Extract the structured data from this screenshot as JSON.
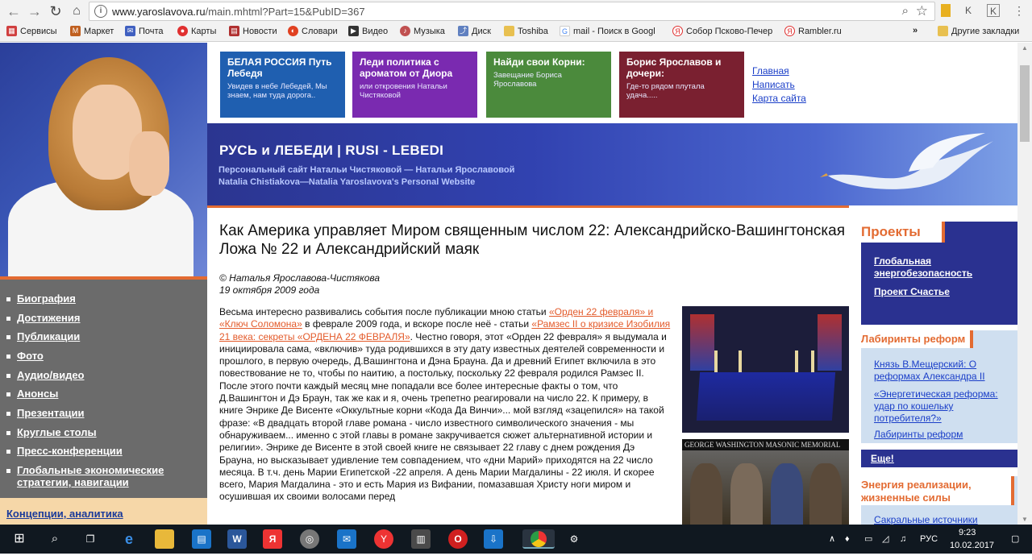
{
  "browser": {
    "url_host": "www.yaroslavova.ru",
    "url_path": "/main.mhtml?Part=15&PubID=367",
    "bookmarks": [
      "Сервисы",
      "Маркет",
      "Почта",
      "Карты",
      "Новости",
      "Словари",
      "Видео",
      "Музыка",
      "Диск",
      "Toshiba",
      "mail - Поиск в Googl",
      "Собор Псково-Печер",
      "Rambler.ru"
    ],
    "more_bookmarks": "»",
    "other_bookmarks": "Другие закладки"
  },
  "tiles": [
    {
      "title": "БЕЛАЯ РОССИЯ Путь Лебедя",
      "sub": "Увидев в небе Лебедей, Мы знаем, нам туда дорога..",
      "color": "#1f5fb0"
    },
    {
      "title": "Леди политика с ароматом от Диора",
      "sub": "или откровения Натальи Чистяковой",
      "color": "#7a2ab0"
    },
    {
      "title": "Найди свои Корни:",
      "sub": "Завещание Бориса Ярославова",
      "color": "#4b8a3c"
    },
    {
      "title": "Борис Ярославов и дочери:",
      "sub": "Где-то рядом плутала удача.....",
      "color": "#7a2030"
    }
  ],
  "toplinks": [
    "Главная",
    "Написать",
    "Карта сайта"
  ],
  "banner": {
    "title": "РУСЬ и ЛЕБЕДИ | RUSI - LEBEDI",
    "sub1": "Персональный сайт Натальи Чистяковой — Натальи Ярославовой",
    "sub2": "Natalia Chistiakova—Natalia Yaroslavova's Personal Website"
  },
  "leftmenu": [
    "Биография",
    "Достижения",
    "Публикации",
    "Фото",
    "Аудио/видео",
    "Анонсы",
    "Презентации",
    "Круглые столы",
    "Пресс-конференции",
    "Глобальные экономические",
    "стратегии, навигации"
  ],
  "leftlower": "Концепции, аналитика",
  "article": {
    "title": "Как Америка управляет Миром священным числом 22: Александрийско-Вашингтонская Ложа № 22 и Александрийский маяк",
    "author": "© Наталья Ярославова-Чистякова",
    "date": "19 октября 2009 года",
    "p1_a": "Весьма интересно развивались события после публикации мною статьи ",
    "link1": "«Орден 22 февраля» и «Ключ Соломона»",
    "p1_b": " в феврале 2009 года, и вскоре после неё - статьи ",
    "link2": "«Рамзес II о кризисе Изобилия 21 века: секреты «ОРДЕНА 22 ФЕВРАЛЯ»",
    "p1_c": ". Честно говоря, этот «Орден 22 февраля» я выдумала и инициировала сама, «включив» туда родившихся в эту дату известных деятелей современности и прошлого, в первую очередь, Д.Вашингтона и Дэна Брауна. Да и древний Египет включила в это повествование не то, чтобы по наитию, а постольку, поскольку 22 февраля родился Рамзес II. После этого почти каждый месяц мне попадали все более интересные факты о том, что Д.Вашингтон и Дэ Браун, так же как и я, очень трепетно реагировали на число 22. К примеру, в книге Энрике Де Висенте «Оккультные корни «Кода Да Винчи»... мой взгляд «зацепился» на такой фразе: «В двадцать второй главе романа - число известного символического значения - мы обнаруживаем... именно с этой главы в романе закручивается сюжет альтернативной истории и религии». Энрике де Висенте в этой своей книге не связывает 22 главу с днем рождения Дэ Брауна, но высказывает удивление тем совпадением, что «дни Марий» приходятся на 22 число месяца. В т.ч. день Марии Египетской -22 апреля. А день Марии Магдалины - 22 июля. И скорее всего, Мария Магдалина - это и есть Мария из Вифании, помазавшая Христу ноги миром и осушившая их своими волосами перед"
  },
  "image2_caption": "GEORGE WASHINGTON MASONIC MEMORIAL",
  "sidebar": {
    "projects_title": "Проекты",
    "projects": [
      "Глобальная энергобезопасность",
      "Проект Счастье"
    ],
    "reforms_title": "Лабиринты реформ",
    "reforms": [
      "Князь В.Мещерский: О реформах Александра II",
      "«Энергетическая реформа: удар по кошельку потребителя?»",
      "Лабиринты реформ"
    ],
    "more": "Еще!",
    "energy_title": "Энергия реализации, жизненные силы",
    "energy": [
      "Сакральные источники"
    ]
  },
  "taskbar": {
    "lang": "РУС",
    "time": "9:23",
    "date": "10.02.2017"
  }
}
